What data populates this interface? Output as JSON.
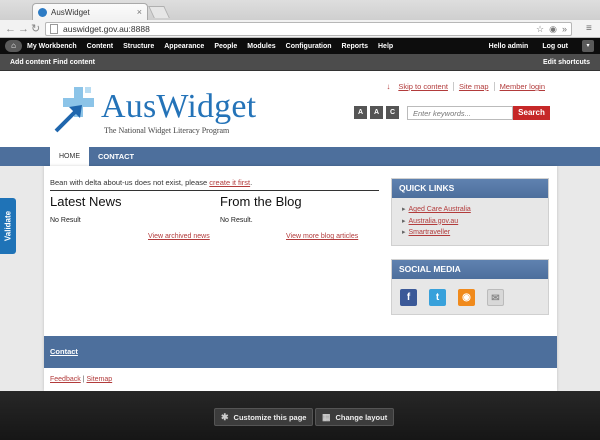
{
  "browser": {
    "tab_title": "AusWidget",
    "tab_close": "×",
    "url": "auswidget.gov.au:8888",
    "back": "←",
    "forward": "→",
    "reload": "↻",
    "more": "»",
    "menu": "≡"
  },
  "admin_toolbar": {
    "home_icon": "home-icon",
    "menu": [
      "My Workbench",
      "Content",
      "Structure",
      "Appearance",
      "People",
      "Modules",
      "Configuration",
      "Reports",
      "Help"
    ],
    "greeting": "Hello admin",
    "logout": "Log out",
    "drawer": "▾"
  },
  "shortcuts": {
    "add_content": "Add content",
    "find_content": "Find content",
    "edit_shortcuts": "Edit shortcuts"
  },
  "header": {
    "top_links": [
      "Skip to content",
      "Site map",
      "Member login"
    ],
    "logo_text": "AusWidget",
    "tagline": "The National Widget Literacy Program",
    "font_buttons": [
      "A",
      "A",
      "C"
    ],
    "search_placeholder": "Enter keywords...",
    "search_button": "Search"
  },
  "nav": {
    "home": "HOME",
    "contact": "CONTACT"
  },
  "validate_label": "Validate",
  "main": {
    "notice_text": "Bean with delta about-us does not exist, please ",
    "notice_link": "create it first",
    "notice_end": ".",
    "latest_news": {
      "title": "Latest News",
      "empty": "No Result",
      "link": "View archived news"
    },
    "blog": {
      "title": "From the Blog",
      "empty": "No Result.",
      "link": "View more blog articles"
    }
  },
  "sidebar": {
    "quick_links": {
      "title": "QUICK LINKS",
      "items": [
        "Aged Care Australia",
        "Australia.gov.au",
        "Smartraveller"
      ]
    },
    "social_media": {
      "title": "SOCIAL MEDIA",
      "icons": [
        "facebook-icon",
        "twitter-icon",
        "rss-icon",
        "email-icon"
      ]
    }
  },
  "footer": {
    "contact": "Contact",
    "feedback": "Feedback",
    "separator": "|",
    "sitemap": "Sitemap"
  },
  "panelizer": {
    "customize": "Customize this page",
    "change_layout": "Change layout"
  },
  "colors": {
    "brand_blue": "#2473b8",
    "nav_blue": "#4d6f9c",
    "link_red": "#b23b3b",
    "search_red": "#c62828"
  }
}
